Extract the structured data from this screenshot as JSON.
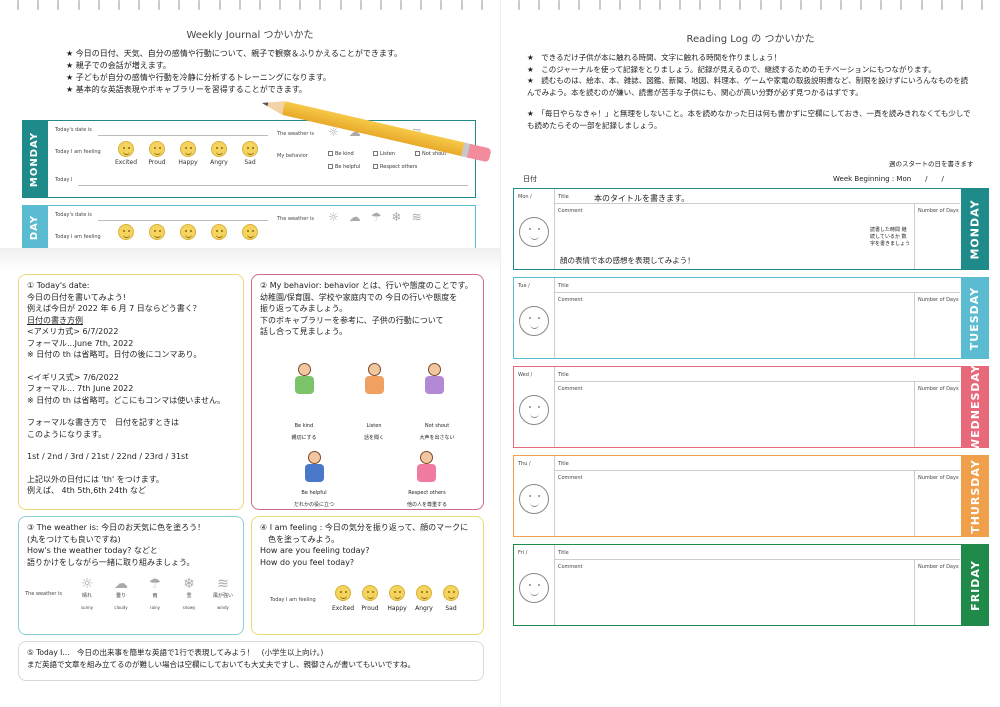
{
  "left": {
    "title": "Weekly Journal つかいかた",
    "intro": [
      "★ 今日の日付、天気、自分の感情や行動について、親子で観察＆ふりかえることができます。",
      "★ 親子での会話が増えます。",
      "★ 子どもが自分の感情や行動を冷静に分析するトレーニングになります。",
      "★ 基本的な英語表現やボキャブラリーを習得することができます。"
    ],
    "monday": {
      "tab": "MONDAY",
      "date_label": "Today's date is",
      "feeling_label": "Today I am feeling",
      "weather_label": "The weather is",
      "behavior_label": "My behavior",
      "today_label": "Today I",
      "emotions": [
        "Excited",
        "Proud",
        "Happy",
        "Angry",
        "Sad"
      ],
      "behaviors": [
        "Be kind",
        "Listen",
        "Not shout",
        "Be helpful",
        "Respect others"
      ]
    },
    "tuesday": {
      "tab": "DAY",
      "date_label": "Today's date is",
      "feeling_label": "Today I am feeling",
      "weather_label": "The weather is"
    },
    "box1": {
      "lines": [
        "① Today's date:",
        "今日の日付を書いてみよう!",
        "例えば今日が 2022 年 6 月 7 日ならどう書く？",
        "日付の書き方例",
        "<アメリカ式> 6/7/2022",
        "フォーマル...June 7th, 2022",
        "※ 日付の th は省略可。日付の後にコンマあり。",
        "",
        "<イギリス式> 7/6/2022",
        " フォーマル... 7th June 2022",
        "※ 日付の th は省略可。どこにもコンマは使いません。",
        "",
        "フォーマルな書き方で　日付を記すときは",
        "このようになります。",
        "",
        "1st / 2nd / 3rd / 21st / 22nd / 23rd / 31st",
        "",
        "上記以外の日付には 'th' をつけます。",
        "例えば、 4th 5th,6th 24th など"
      ]
    },
    "box2": {
      "lines": [
        "② My behavior: behavior とは、行いや態度のことです。",
        "幼稚園/保育園、学校や家庭内での 今日の行いや態度を",
        "振り返ってみましょう。",
        "下のボキャブラリーを参考に、子供の行動について",
        "話し合って見ましょう。"
      ],
      "kids": [
        {
          "en": "Be kind",
          "jp": "親切にする"
        },
        {
          "en": "Listen",
          "jp": "話を聞く"
        },
        {
          "en": "Not shout",
          "jp": "大声を出さない"
        },
        {
          "en": "Be helpful",
          "jp": "だれかの役に立つ"
        },
        {
          "en": "Respect others",
          "jp": "他の人を尊重する"
        }
      ]
    },
    "box3": {
      "lines": [
        "③ The weather is: 今日のお天気に色を塗ろう！",
        "(丸をつけても良いですね)",
        "How's the weather today? などと",
        "語りかけをしながら一緒に取り組みましょう。"
      ],
      "weather_label": "The weather is",
      "weather": [
        {
          "jp": "晴れ",
          "en": "sunny"
        },
        {
          "jp": "曇り",
          "en": "cloudy"
        },
        {
          "jp": "雨",
          "en": "rainy"
        },
        {
          "jp": "雪",
          "en": "snowy"
        },
        {
          "jp": "風が強い",
          "en": "windy"
        }
      ]
    },
    "box4": {
      "lines": [
        "④ I am feeling : 今日の気分を振り返って、顔のマークに",
        "　色を塗ってみよう。",
        "How are you feeling today?",
        "How do you feel today?"
      ],
      "feeling_label": "Today I am feeling",
      "emotions": [
        "Excited",
        "Proud",
        "Happy",
        "Angry",
        "Sad"
      ]
    },
    "box5": {
      "lines": [
        "⑤ Today I...　今日の出来事を簡単な英語で1行で表現してみよう！　(小学生以上向け。)",
        "まだ英語で文章を組み立てるのが難しい場合は空欄にしておいても大丈夫ですし、親御さんが書いてもいいですね。"
      ]
    }
  },
  "right": {
    "title": "Reading Log の つかいかた",
    "intro": [
      "★　できるだけ子供が本に触れる時間、文字に触れる時間を作りましょう！",
      "★　このジャーナルを使って記録をとりましょう。記録が見えるので、継続するためのモチベーションにもつながります。",
      "★　読むものは、絵本、本、雑誌、図鑑、新聞、地図、料理本、ゲームや家電の取扱説明書など、制限を設けずにいろんなものを読んでみよう。本を読むのが嫌い、読書が苦手な子供にも、関心が高い分野が必ず見つかるはずです。",
      "★　「毎日やらなきゃ！」と無理をしないこと。本を読めなかった日は何も書かずに空欄にしておき、一頁を読みきれなくても少しでも読めたらその一部を記録しましょう。"
    ],
    "note_top": "週のスタートの日を書きます",
    "date_note": "日付",
    "week_label": "Week Beginning :",
    "week_value": "Mon　　/　　/",
    "title_note": "本のタイトルを書きます。",
    "pages_note": "読書した時間 継続しているか 数字を書きましょう",
    "face_note": "顔の表情で本の感想を表現してみよう！",
    "days": [
      {
        "tab": "MONDAY",
        "day": "Mon",
        "color": "#1e8a8a"
      },
      {
        "tab": "TUESDAY",
        "day": "Tue",
        "color": "#5bbbd0"
      },
      {
        "tab": "WEDNESDAY",
        "day": "Wed",
        "color": "#e8697a"
      },
      {
        "tab": "THURSDAY",
        "day": "Thu",
        "color": "#f0a04a"
      },
      {
        "tab": "FRIDAY",
        "day": "Fri",
        "color": "#1f8a4a"
      }
    ],
    "fields": {
      "title": "Title",
      "comment": "Comment",
      "pages": "Number of Days",
      "slash": "/"
    }
  }
}
